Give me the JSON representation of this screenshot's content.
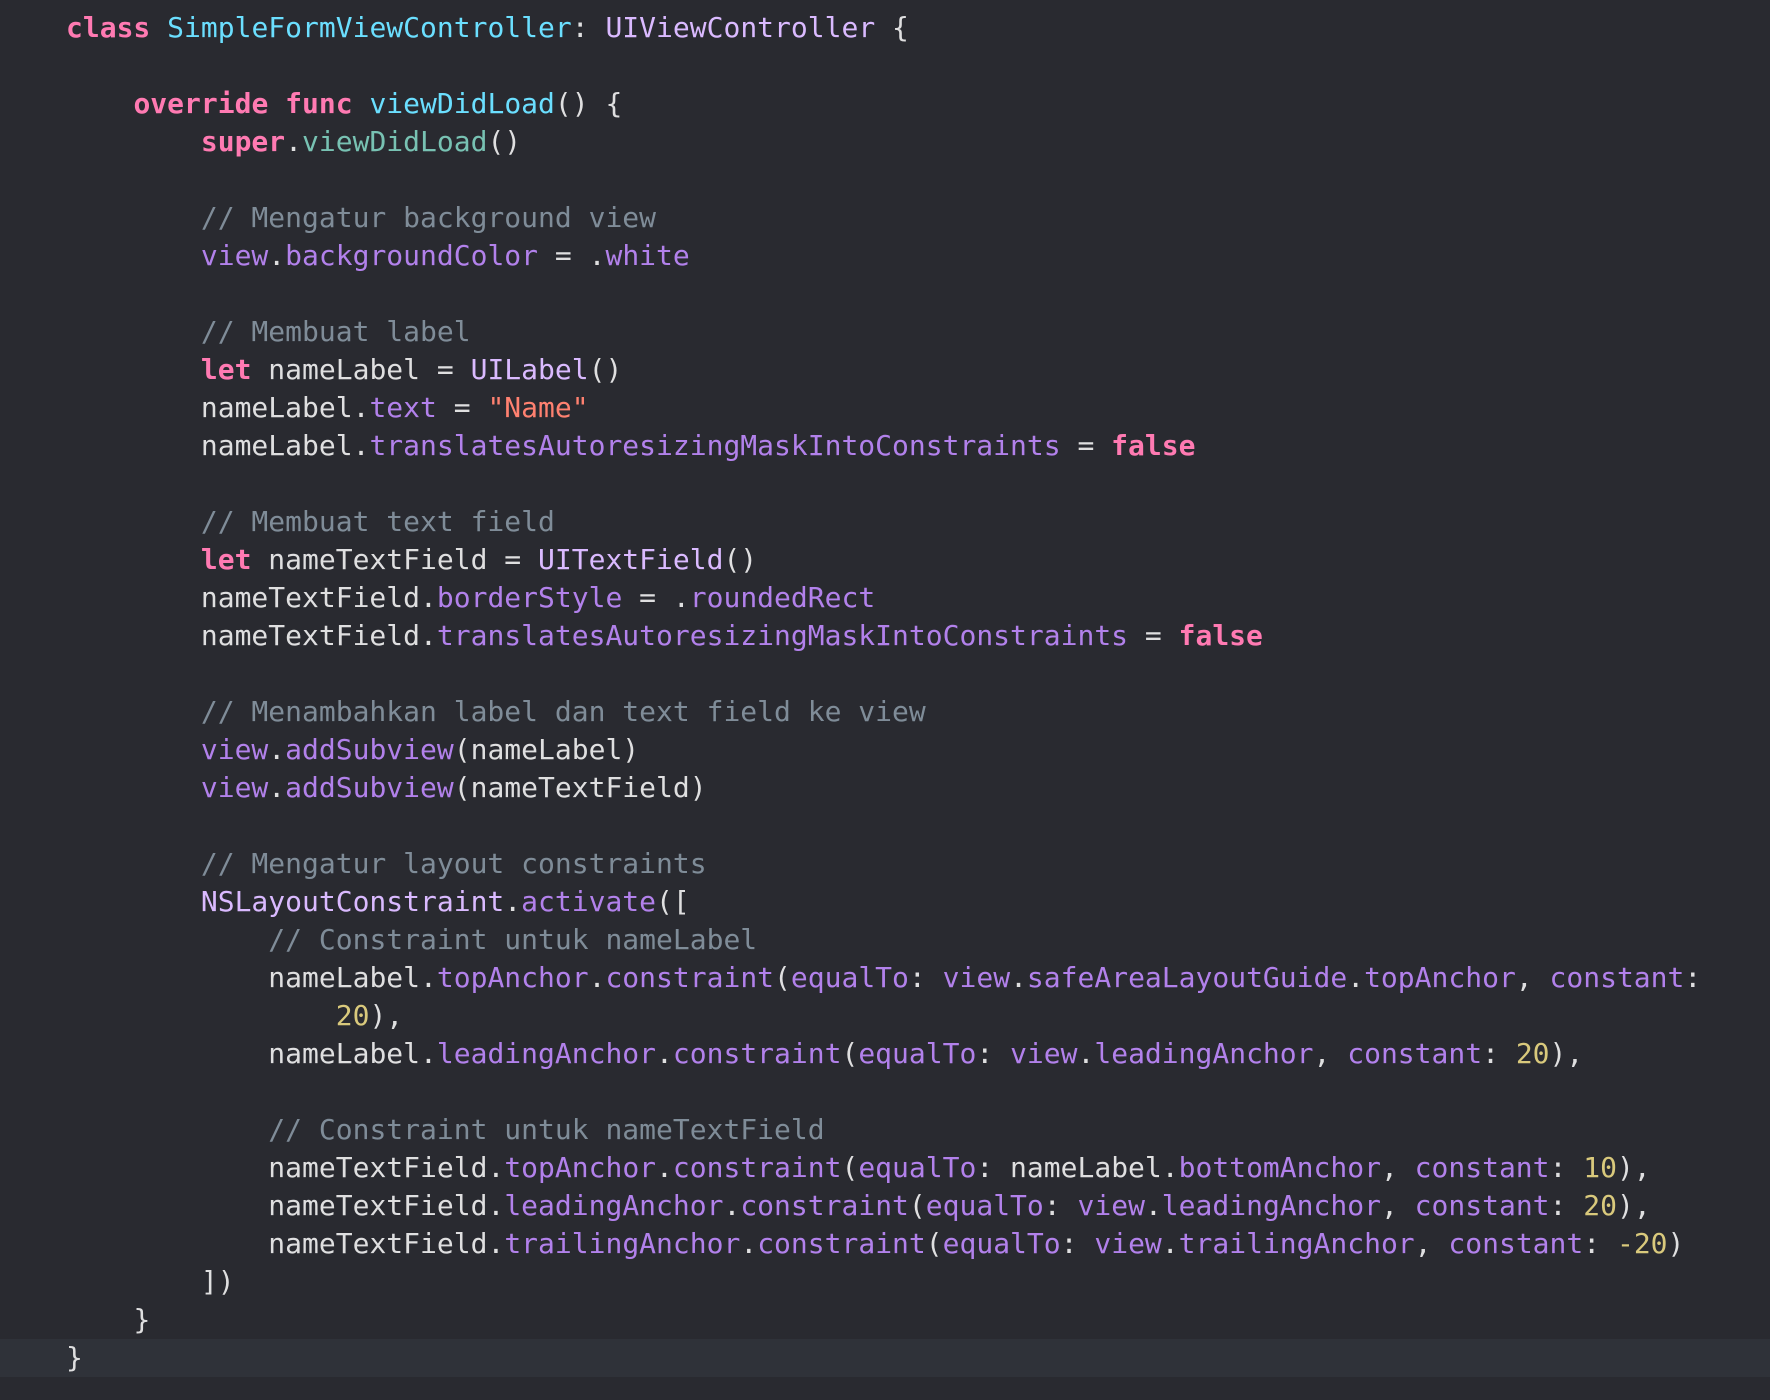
{
  "editor": {
    "language": "Swift",
    "current_line_index": 35,
    "colors": {
      "background": "#292a30",
      "current_line": "#2f3239",
      "keyword": "#ff7ab2",
      "declaration": "#6bdfff",
      "type": "#dabaff",
      "property": "#b281eb",
      "function": "#78c2b3",
      "string": "#ff8170",
      "number": "#d9c97c",
      "comment": "#7f8c98",
      "plain": "#dfdfe0"
    },
    "lines": [
      {
        "indent": 0,
        "tokens": [
          [
            "kw",
            "class"
          ],
          [
            "plain",
            " "
          ],
          [
            "decl",
            "SimpleFormViewController"
          ],
          [
            "plain",
            ": "
          ],
          [
            "type",
            "UIViewController"
          ],
          [
            "plain",
            " {"
          ]
        ]
      },
      {
        "indent": 0,
        "tokens": []
      },
      {
        "indent": 4,
        "tokens": [
          [
            "kw",
            "override"
          ],
          [
            "plain",
            " "
          ],
          [
            "kw",
            "func"
          ],
          [
            "plain",
            " "
          ],
          [
            "decl",
            "viewDidLoad"
          ],
          [
            "plain",
            "() {"
          ]
        ]
      },
      {
        "indent": 8,
        "tokens": [
          [
            "kw",
            "super"
          ],
          [
            "plain",
            "."
          ],
          [
            "func",
            "viewDidLoad"
          ],
          [
            "plain",
            "()"
          ]
        ]
      },
      {
        "indent": 0,
        "tokens": []
      },
      {
        "indent": 8,
        "tokens": [
          [
            "cmt",
            "// Mengatur background view"
          ]
        ]
      },
      {
        "indent": 8,
        "tokens": [
          [
            "prop",
            "view"
          ],
          [
            "plain",
            "."
          ],
          [
            "prop",
            "backgroundColor"
          ],
          [
            "plain",
            " = ."
          ],
          [
            "prop",
            "white"
          ]
        ]
      },
      {
        "indent": 0,
        "tokens": []
      },
      {
        "indent": 8,
        "tokens": [
          [
            "cmt",
            "// Membuat label"
          ]
        ]
      },
      {
        "indent": 8,
        "tokens": [
          [
            "kw",
            "let"
          ],
          [
            "plain",
            " nameLabel = "
          ],
          [
            "type",
            "UILabel"
          ],
          [
            "plain",
            "()"
          ]
        ]
      },
      {
        "indent": 8,
        "tokens": [
          [
            "plain",
            "nameLabel."
          ],
          [
            "prop",
            "text"
          ],
          [
            "plain",
            " = "
          ],
          [
            "str",
            "\"Name\""
          ]
        ]
      },
      {
        "indent": 8,
        "tokens": [
          [
            "plain",
            "nameLabel."
          ],
          [
            "prop",
            "translatesAutoresizingMaskIntoConstraints"
          ],
          [
            "plain",
            " = "
          ],
          [
            "kw",
            "false"
          ]
        ]
      },
      {
        "indent": 0,
        "tokens": []
      },
      {
        "indent": 8,
        "tokens": [
          [
            "cmt",
            "// Membuat text field"
          ]
        ]
      },
      {
        "indent": 8,
        "tokens": [
          [
            "kw",
            "let"
          ],
          [
            "plain",
            " nameTextField = "
          ],
          [
            "type",
            "UITextField"
          ],
          [
            "plain",
            "()"
          ]
        ]
      },
      {
        "indent": 8,
        "tokens": [
          [
            "plain",
            "nameTextField."
          ],
          [
            "prop",
            "borderStyle"
          ],
          [
            "plain",
            " = ."
          ],
          [
            "prop",
            "roundedRect"
          ]
        ]
      },
      {
        "indent": 8,
        "tokens": [
          [
            "plain",
            "nameTextField."
          ],
          [
            "prop",
            "translatesAutoresizingMaskIntoConstraints"
          ],
          [
            "plain",
            " = "
          ],
          [
            "kw",
            "false"
          ]
        ]
      },
      {
        "indent": 0,
        "tokens": []
      },
      {
        "indent": 8,
        "tokens": [
          [
            "cmt",
            "// Menambahkan label dan text field ke view"
          ]
        ]
      },
      {
        "indent": 8,
        "tokens": [
          [
            "prop",
            "view"
          ],
          [
            "plain",
            "."
          ],
          [
            "prop",
            "addSubview"
          ],
          [
            "plain",
            "(nameLabel)"
          ]
        ]
      },
      {
        "indent": 8,
        "tokens": [
          [
            "prop",
            "view"
          ],
          [
            "plain",
            "."
          ],
          [
            "prop",
            "addSubview"
          ],
          [
            "plain",
            "(nameTextField)"
          ]
        ]
      },
      {
        "indent": 0,
        "tokens": []
      },
      {
        "indent": 8,
        "tokens": [
          [
            "cmt",
            "// Mengatur layout constraints"
          ]
        ]
      },
      {
        "indent": 8,
        "tokens": [
          [
            "type",
            "NSLayoutConstraint"
          ],
          [
            "plain",
            "."
          ],
          [
            "prop",
            "activate"
          ],
          [
            "plain",
            "(["
          ]
        ]
      },
      {
        "indent": 12,
        "tokens": [
          [
            "cmt",
            "// Constraint untuk nameLabel"
          ]
        ]
      },
      {
        "indent": 12,
        "tokens": [
          [
            "plain",
            "nameLabel."
          ],
          [
            "prop",
            "topAnchor"
          ],
          [
            "plain",
            "."
          ],
          [
            "prop",
            "constraint"
          ],
          [
            "plain",
            "("
          ],
          [
            "prop",
            "equalTo"
          ],
          [
            "plain",
            ": "
          ],
          [
            "prop",
            "view"
          ],
          [
            "plain",
            "."
          ],
          [
            "prop",
            "safeAreaLayoutGuide"
          ],
          [
            "plain",
            "."
          ],
          [
            "prop",
            "topAnchor"
          ],
          [
            "plain",
            ", "
          ],
          [
            "prop",
            "constant"
          ],
          [
            "plain",
            ":"
          ]
        ]
      },
      {
        "indent": 16,
        "tokens": [
          [
            "num",
            "20"
          ],
          [
            "plain",
            "),"
          ]
        ]
      },
      {
        "indent": 12,
        "tokens": [
          [
            "plain",
            "nameLabel."
          ],
          [
            "prop",
            "leadingAnchor"
          ],
          [
            "plain",
            "."
          ],
          [
            "prop",
            "constraint"
          ],
          [
            "plain",
            "("
          ],
          [
            "prop",
            "equalTo"
          ],
          [
            "plain",
            ": "
          ],
          [
            "prop",
            "view"
          ],
          [
            "plain",
            "."
          ],
          [
            "prop",
            "leadingAnchor"
          ],
          [
            "plain",
            ", "
          ],
          [
            "prop",
            "constant"
          ],
          [
            "plain",
            ": "
          ],
          [
            "num",
            "20"
          ],
          [
            "plain",
            "),"
          ]
        ]
      },
      {
        "indent": 0,
        "tokens": []
      },
      {
        "indent": 12,
        "tokens": [
          [
            "cmt",
            "// Constraint untuk nameTextField"
          ]
        ]
      },
      {
        "indent": 12,
        "tokens": [
          [
            "plain",
            "nameTextField."
          ],
          [
            "prop",
            "topAnchor"
          ],
          [
            "plain",
            "."
          ],
          [
            "prop",
            "constraint"
          ],
          [
            "plain",
            "("
          ],
          [
            "prop",
            "equalTo"
          ],
          [
            "plain",
            ": nameLabel."
          ],
          [
            "prop",
            "bottomAnchor"
          ],
          [
            "plain",
            ", "
          ],
          [
            "prop",
            "constant"
          ],
          [
            "plain",
            ": "
          ],
          [
            "num",
            "10"
          ],
          [
            "plain",
            "),"
          ]
        ]
      },
      {
        "indent": 12,
        "tokens": [
          [
            "plain",
            "nameTextField."
          ],
          [
            "prop",
            "leadingAnchor"
          ],
          [
            "plain",
            "."
          ],
          [
            "prop",
            "constraint"
          ],
          [
            "plain",
            "("
          ],
          [
            "prop",
            "equalTo"
          ],
          [
            "plain",
            ": "
          ],
          [
            "prop",
            "view"
          ],
          [
            "plain",
            "."
          ],
          [
            "prop",
            "leadingAnchor"
          ],
          [
            "plain",
            ", "
          ],
          [
            "prop",
            "constant"
          ],
          [
            "plain",
            ": "
          ],
          [
            "num",
            "20"
          ],
          [
            "plain",
            "),"
          ]
        ]
      },
      {
        "indent": 12,
        "tokens": [
          [
            "plain",
            "nameTextField."
          ],
          [
            "prop",
            "trailingAnchor"
          ],
          [
            "plain",
            "."
          ],
          [
            "prop",
            "constraint"
          ],
          [
            "plain",
            "("
          ],
          [
            "prop",
            "equalTo"
          ],
          [
            "plain",
            ": "
          ],
          [
            "prop",
            "view"
          ],
          [
            "plain",
            "."
          ],
          [
            "prop",
            "trailingAnchor"
          ],
          [
            "plain",
            ", "
          ],
          [
            "prop",
            "constant"
          ],
          [
            "plain",
            ": "
          ],
          [
            "num",
            "-20"
          ],
          [
            "plain",
            ")"
          ]
        ]
      },
      {
        "indent": 8,
        "tokens": [
          [
            "plain",
            "])"
          ]
        ]
      },
      {
        "indent": 4,
        "tokens": [
          [
            "plain",
            "}"
          ]
        ]
      },
      {
        "indent": 0,
        "tokens": [
          [
            "plain",
            "}"
          ]
        ]
      }
    ]
  }
}
